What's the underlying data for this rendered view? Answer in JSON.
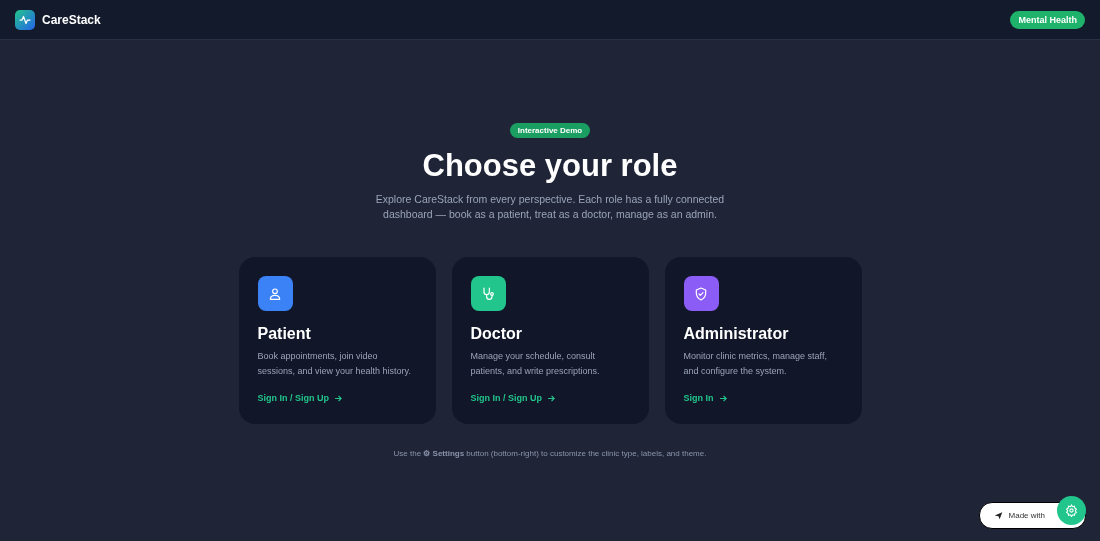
{
  "header": {
    "brand": "CareStack",
    "badge": "Mental Health"
  },
  "hero": {
    "tag": "Interactive Demo",
    "title": "Choose your role",
    "subtitle": "Explore CareStack from every perspective. Each role has a fully connected dashboard — book as a patient, treat as a doctor, manage as an admin."
  },
  "roles": [
    {
      "kind": "person",
      "color": "#3b82f6",
      "title": "Patient",
      "description": "Book appointments, join video sessions, and view your health history.",
      "link": "Sign In / Sign Up"
    },
    {
      "kind": "stethoscope",
      "color": "#22c58b",
      "title": "Doctor",
      "description": "Manage your schedule, consult patients, and write prescriptions.",
      "link": "Sign In / Sign Up"
    },
    {
      "kind": "shield",
      "color": "#8b5cf6",
      "title": "Administrator",
      "description": "Monitor clinic metrics, manage staff, and configure the system.",
      "link": "Sign In"
    }
  ],
  "footnote": "Use the **⚙ Settings** button (bottom-right) to customize the clinic type, labels, and theme.",
  "made_with": "Made with"
}
